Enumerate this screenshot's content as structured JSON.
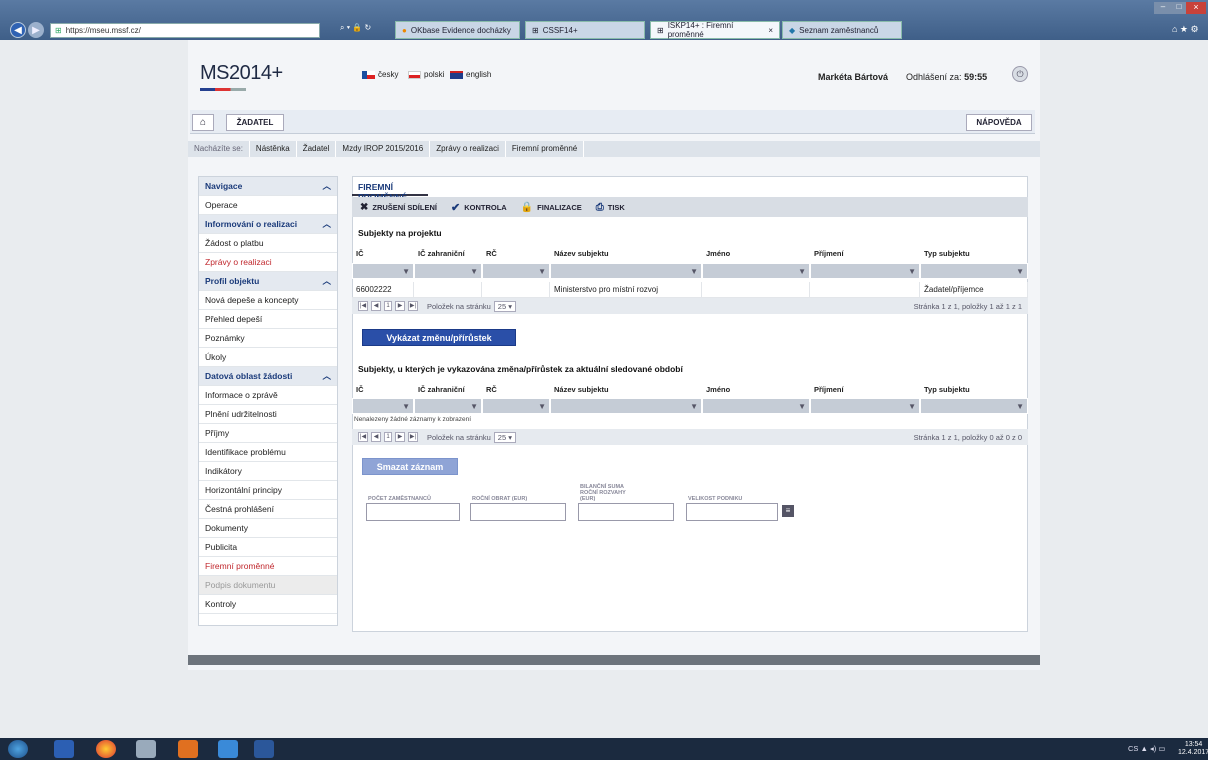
{
  "browser": {
    "address": "https://mseu.mssf.cz/",
    "tabs": [
      {
        "label": "OKbase Evidence docházky"
      },
      {
        "label": "CSSF14+"
      },
      {
        "label": "ISKP14+ : Firemní proměnné"
      },
      {
        "label": "Seznam zaměstnanců"
      }
    ]
  },
  "header": {
    "logo": "MS2014+",
    "languages": [
      "česky",
      "polski",
      "english"
    ],
    "user_name": "Markéta Bártová",
    "logout_label": "Odhlášení za:",
    "logout_time": "59:55"
  },
  "rolebar": {
    "role": "ŽADATEL",
    "help": "NÁPOVĚDA"
  },
  "breadcrumb": {
    "prefix": "Nacházíte se:",
    "items": [
      "Nástěnka",
      "Žadatel",
      "Mzdy IROP 2015/2016",
      "Zprávy o realizaci",
      "Firemní proměnné"
    ]
  },
  "sidebar": {
    "items": [
      {
        "label": "Navigace",
        "type": "sec"
      },
      {
        "label": "Operace",
        "type": "item"
      },
      {
        "label": "Informování o realizaci",
        "type": "sec"
      },
      {
        "label": "Žádost o platbu",
        "type": "item"
      },
      {
        "label": "Zprávy o realizaci",
        "type": "red"
      },
      {
        "label": "Profil objektu",
        "type": "sec"
      },
      {
        "label": "Nová depeše a koncepty",
        "type": "item"
      },
      {
        "label": "Přehled depeší",
        "type": "item"
      },
      {
        "label": "Poznámky",
        "type": "item"
      },
      {
        "label": "Úkoly",
        "type": "item"
      },
      {
        "label": "Datová oblast žádosti",
        "type": "sec"
      },
      {
        "label": "Informace o zprávě",
        "type": "item"
      },
      {
        "label": "Plnění udržitelnosti",
        "type": "item"
      },
      {
        "label": "Příjmy",
        "type": "item"
      },
      {
        "label": "Identifikace problému",
        "type": "item"
      },
      {
        "label": "Indikátory",
        "type": "item"
      },
      {
        "label": "Horizontální principy",
        "type": "item"
      },
      {
        "label": "Čestná prohlášení",
        "type": "item"
      },
      {
        "label": "Dokumenty",
        "type": "item"
      },
      {
        "label": "Publicita",
        "type": "item"
      },
      {
        "label": "Firemní proměnné",
        "type": "red"
      },
      {
        "label": "Podpis dokumentu",
        "type": "dis"
      },
      {
        "label": "Kontroly",
        "type": "item"
      }
    ]
  },
  "main": {
    "title": "FIREMNÍ PROMĚNNÉ",
    "toolbar": [
      "ZRUŠENÍ SDÍLENÍ",
      "KONTROLA",
      "FINALIZACE",
      "TISK"
    ],
    "table1": {
      "heading": "Subjekty na projektu",
      "columns": [
        "IČ",
        "IČ zahraniční",
        "RČ",
        "Název subjektu",
        "Jméno",
        "Příjmení",
        "Typ subjektu"
      ],
      "rows": [
        [
          "66002222",
          "",
          "",
          "Ministerstvo pro místní rozvoj",
          "",
          "",
          "Žadatel/příjemce"
        ]
      ],
      "page": "1",
      "per_page_label": "Položek na stránku",
      "per_page": "25",
      "info": "Stránka 1 z 1, položky 1 až 1 z 1"
    },
    "report_button": "Vykázat změnu/přírůstek",
    "table2": {
      "heading": "Subjekty, u kterých je vykazována změna/přírůstek za aktuální sledované období",
      "columns": [
        "IČ",
        "IČ zahraniční",
        "RČ",
        "Název subjektu",
        "Jméno",
        "Příjmení",
        "Typ subjektu"
      ],
      "empty": "Nenalezeny žádné záznamy k zobrazení",
      "page": "1",
      "per_page_label": "Položek na stránku",
      "per_page": "25",
      "info": "Stránka 1 z 1, položky 0 až 0 z 0"
    },
    "delete_button": "Smazat záznam",
    "fields": [
      {
        "label": "POČET ZAMĚSTNANCŮ"
      },
      {
        "label": "ROČNÍ OBRAT (EUR)"
      },
      {
        "label": "BILANČNÍ SUMA ROČNÍ ROZVAHY (EUR)"
      },
      {
        "label": "VELIKOST PODNIKU"
      }
    ]
  },
  "taskbar": {
    "lang": "CS",
    "time": "13:54",
    "date": "12.4.2017"
  }
}
